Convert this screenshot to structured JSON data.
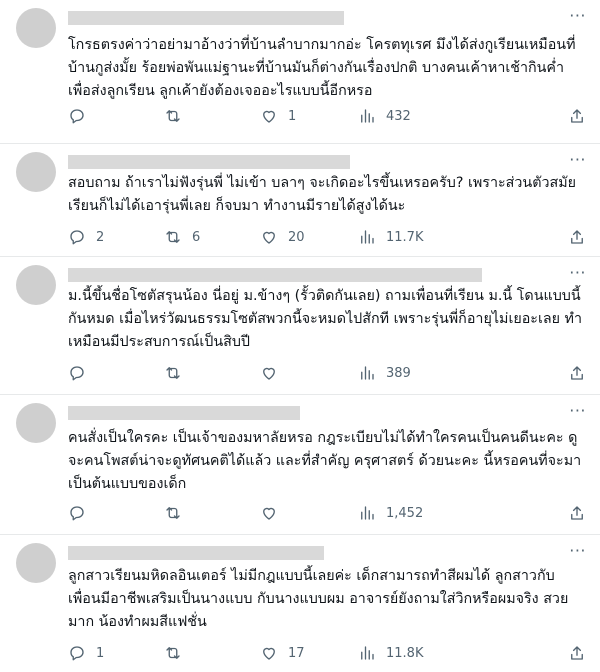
{
  "icons": {
    "reply": "reply-icon",
    "retweet": "retweet-icon",
    "like": "heart-icon",
    "views": "views-icon",
    "share": "share-icon",
    "more": "more-icon"
  },
  "more_label": "···",
  "replies": [
    {
      "text": "โกรธตรงค่าว่าอย่ามาอ้างว่าที่บ้านลำบากมากอ่ะ โครตทุเรศ มึงได้ส่งกูเรียนเหมือนที่บ้านกูส่งมั้ย ร้อยพ่อพันแม่ฐานะที่บ้านมันก็ต่างกันเรื่องปกติ บางคนเค้าหาเช้ากินค่ำเพื่อส่งลูกเรียน ลูกเค้ายังต้องเจออะไรแบบนี้อีกหรอ",
      "reply_count": "",
      "retweet_count": "",
      "like_count": "1",
      "view_count": "432"
    },
    {
      "text": "สอบถาม ถ้าเราไม่ฟังรุ่นพี่ ไม่เข้า บลาๆ จะเกิดอะไรขึ้นเหรอครับ? เพราะส่วนตัวสมัยเรียนก็ไม่ได้เอารุ่นพี่เลย ก็จบมา ทำงานมีรายได้สูงได้นะ",
      "reply_count": "2",
      "retweet_count": "6",
      "like_count": "20",
      "view_count": "11.7K"
    },
    {
      "text": "ม.นี้ขึ้นชื่อโซตัสรุนน้อง นี่อยู่ ม.ข้างๆ (รั้วติดกันเลย) ถามเพื่อนที่เรียน ม.นี้ โดนแบบนี้กันหมด เมื่อไหร่วัฒนธรรมโซตัสพวกนี้จะหมดไปสักที เพราะรุ่นพี่ก็อายุไม่เยอะเลย ทำเหมือนมีประสบการณ์เป็นสิบปี",
      "reply_count": "",
      "retweet_count": "",
      "like_count": "",
      "view_count": "389"
    },
    {
      "text": "คนสั่งเป็นใครคะ เป็นเจ้าของมหาลัยหรอ กฎระเบียบไม่ได้ทำใครคนเป็นคนดีนะคะ ดูจะคนโพสต์น่าจะดูทัศนคติได้แล้ว และที่สำคัญ ครุศาสตร์ ด้วยนะคะ นี้หรอคนที่จะมาเป็นต้นแบบของเด็ก",
      "reply_count": "",
      "retweet_count": "",
      "like_count": "",
      "view_count": "1,452"
    },
    {
      "text": "ลูกสาวเรียนมหิดลอินเตอร์ ไม่มีกฎแบบนี้เลยค่ะ เด็กสามารถทำสีผมได้ ลูกสาวกับเพื่อนมีอาชีพเสริมเป็นนางแบบ กับนางแบบผม อาจารย์ยังถามใส่วิกหรือผมจริง สวยมาก น้องทำผมสีแฟชั่น",
      "reply_count": "1",
      "retweet_count": "",
      "like_count": "17",
      "view_count": "11.8K"
    }
  ]
}
